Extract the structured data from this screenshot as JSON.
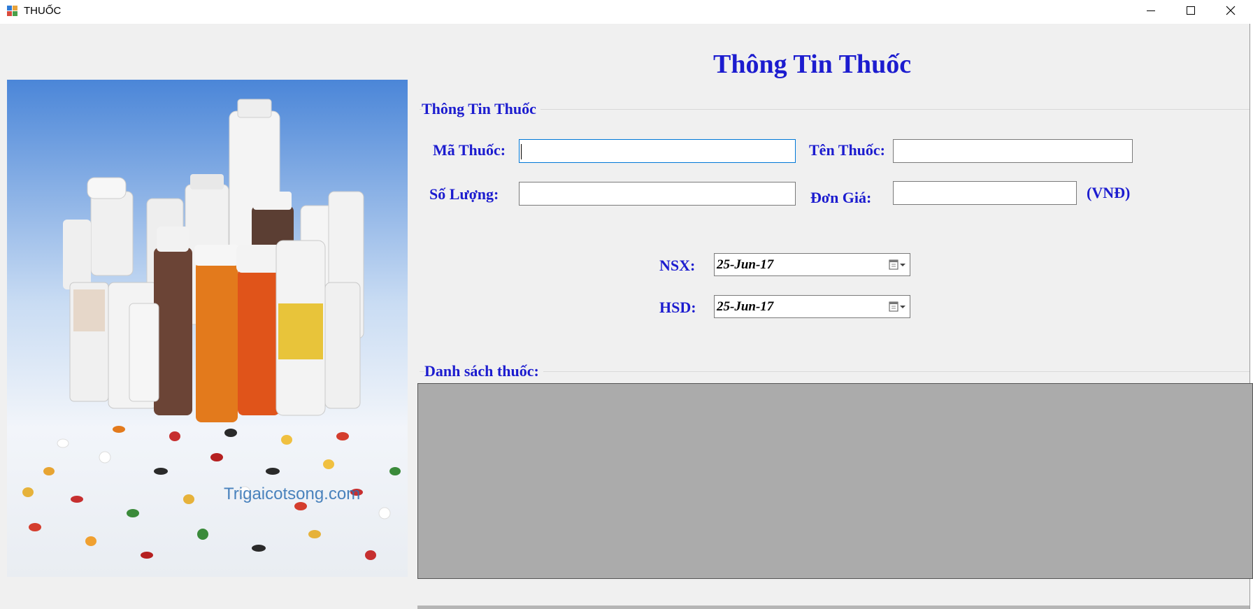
{
  "window": {
    "title": "THUỐC"
  },
  "form": {
    "heading": "Thông Tin Thuốc",
    "info_group": {
      "label": "Thông Tin Thuốc",
      "ma_thuoc_label": "Mã Thuốc:",
      "ma_thuoc_value": "",
      "ten_thuoc_label": "Tên Thuốc:",
      "ten_thuoc_value": "",
      "so_luong_label": "Số Lượng:",
      "so_luong_value": "",
      "don_gia_label": "Đơn Giá:",
      "don_gia_value": "",
      "currency_label": "(VNĐ)",
      "nsx_label": "NSX:",
      "nsx_value": "25-Jun-17",
      "hsd_label": "HSD:",
      "hsd_value": "25-Jun-17"
    },
    "list_group": {
      "label": "Danh sách thuốc:"
    }
  },
  "image": {
    "description_icon": "medicine-bottles-photo",
    "watermark": "Trigaicotsong.com"
  },
  "colors": {
    "accent": "#1c1ccf",
    "background": "#f0f0f0",
    "grid_background": "#ababab"
  }
}
